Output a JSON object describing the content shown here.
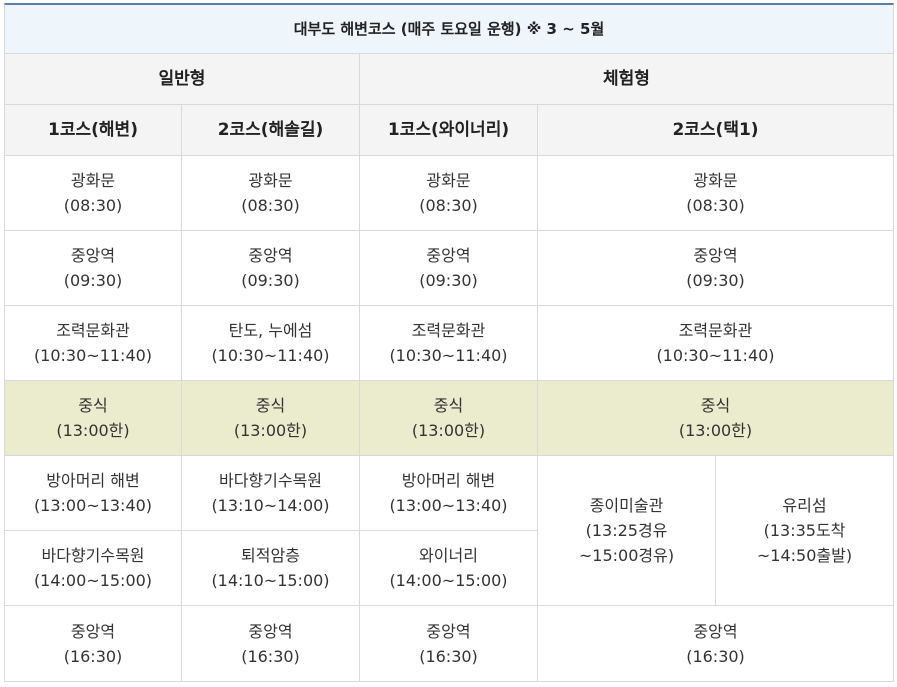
{
  "title": "대부도 해변코스 (매주 토요일 운행) ※ 3 ~ 5월",
  "groups": {
    "general": "일반형",
    "experience": "체험형"
  },
  "courses": {
    "c1": "1코스(해변)",
    "c2": "2코스(해솔길)",
    "c3": "1코스(와이너리)",
    "c4": "2코스(택1)"
  },
  "rows": {
    "r1": {
      "c1": {
        "name": "광화문",
        "time": "(08:30)"
      },
      "c2": {
        "name": "광화문",
        "time": "(08:30)"
      },
      "c3": {
        "name": "광화문",
        "time": "(08:30)"
      },
      "c4": {
        "name": "광화문",
        "time": "(08:30)"
      }
    },
    "r2": {
      "c1": {
        "name": "중앙역",
        "time": "(09:30)"
      },
      "c2": {
        "name": "중앙역",
        "time": "(09:30)"
      },
      "c3": {
        "name": "중앙역",
        "time": "(09:30)"
      },
      "c4": {
        "name": "중앙역",
        "time": "(09:30)"
      }
    },
    "r3": {
      "c1": {
        "name": "조력문화관",
        "time": "(10:30~11:40)"
      },
      "c2": {
        "name": "탄도, 누에섬",
        "time": "(10:30~11:40)"
      },
      "c3": {
        "name": "조력문화관",
        "time": "(10:30~11:40)"
      },
      "c4": {
        "name": "조력문화관",
        "time": "(10:30~11:40)"
      }
    },
    "r4": {
      "c1": {
        "name": "중식",
        "time": "(13:00한)"
      },
      "c2": {
        "name": "중식",
        "time": "(13:00한)"
      },
      "c3": {
        "name": "중식",
        "time": "(13:00한)"
      },
      "c4": {
        "name": "중식",
        "time": "(13:00한)"
      }
    },
    "r5": {
      "c1": {
        "name": "방아머리 해변",
        "time": "(13:00~13:40)"
      },
      "c2": {
        "name": "바다향기수목원",
        "time": "(13:10~14:00)"
      },
      "c3": {
        "name": "방아머리 해변",
        "time": "(13:00~13:40)"
      }
    },
    "r6": {
      "c1": {
        "name": "바다향기수목원",
        "time": "(14:00~15:00)"
      },
      "c2": {
        "name": "퇴적암층",
        "time": "(14:10~15:00)"
      },
      "c3": {
        "name": "와이너리",
        "time": "(14:00~15:00)"
      }
    },
    "opt_a": {
      "name": "종이미술관",
      "line2": "(13:25경유",
      "line3": "~15:00경유)"
    },
    "opt_b": {
      "name": "유리섬",
      "line2": "(13:35도착",
      "line3": "~14:50출발)"
    },
    "r7": {
      "c1": {
        "name": "중앙역",
        "time": "(16:30)"
      },
      "c2": {
        "name": "중앙역",
        "time": "(16:30)"
      },
      "c3": {
        "name": "중앙역",
        "time": "(16:30)"
      },
      "c4": {
        "name": "중앙역",
        "time": "(16:30)"
      }
    }
  },
  "colors": {
    "title_bg": "#eef5fb",
    "title_border": "#5b7fa6",
    "header_bg": "#f4f4f4",
    "lunch_bg": "#ebebce",
    "border": "#d9d9d9",
    "text": "#333333"
  }
}
